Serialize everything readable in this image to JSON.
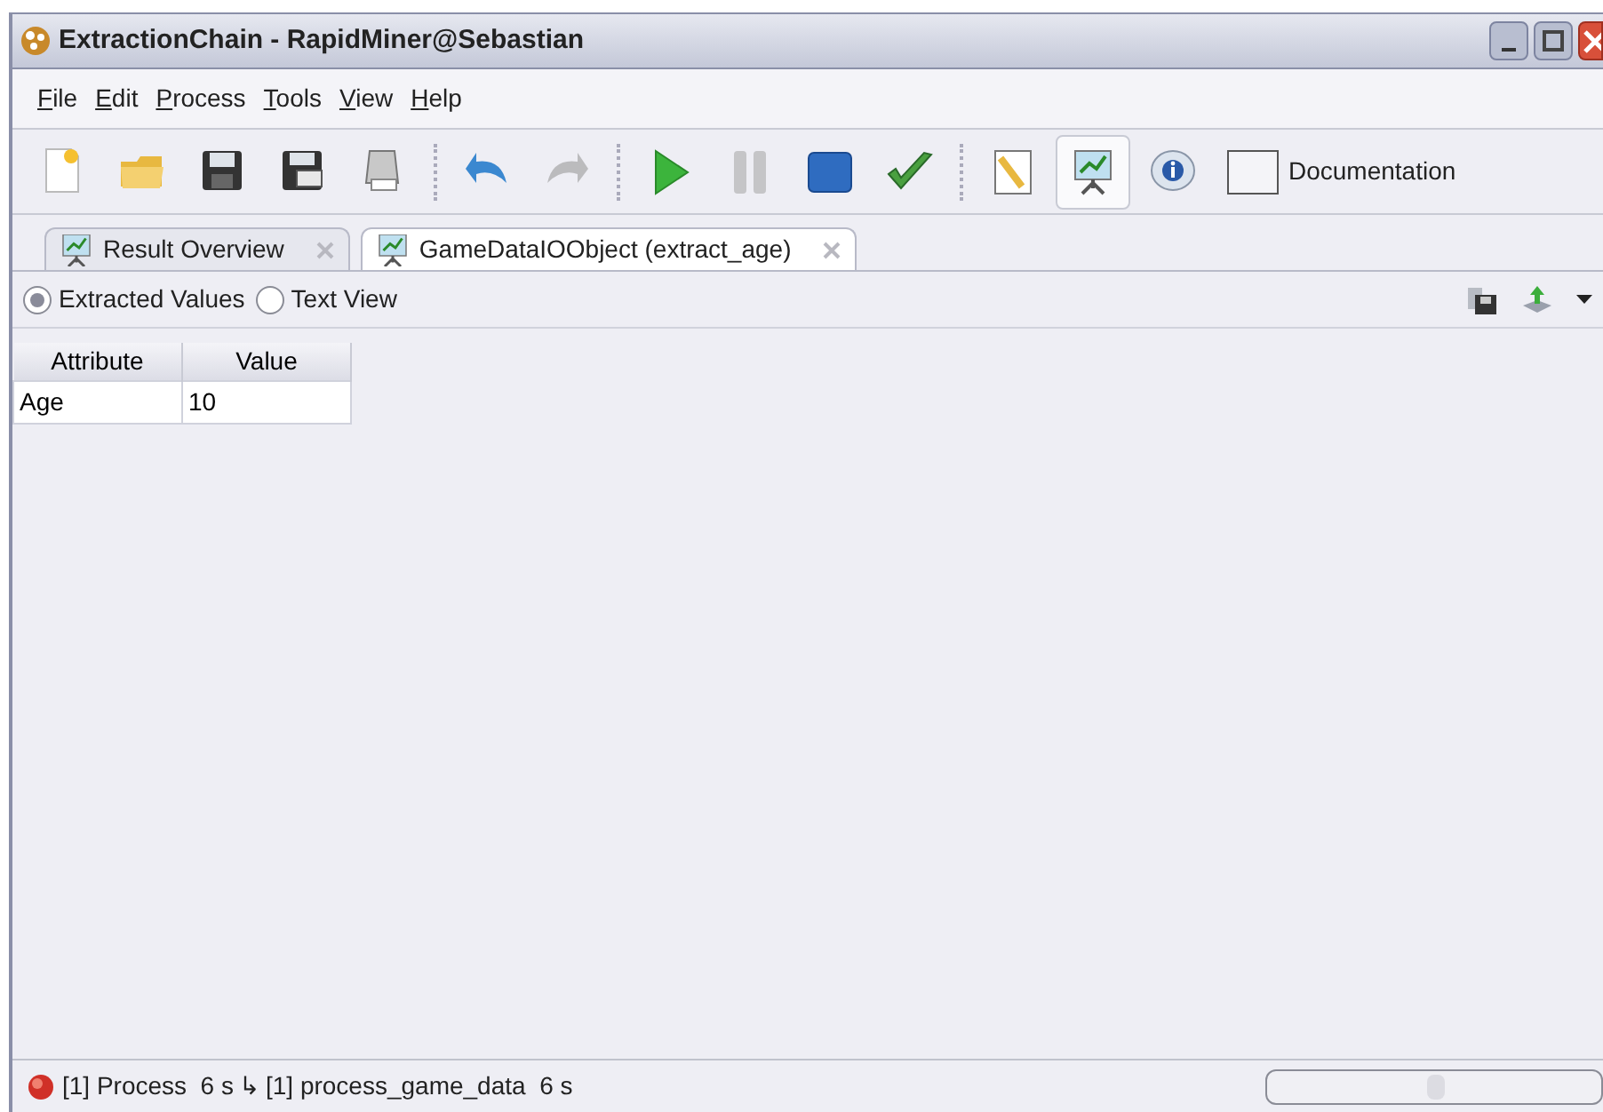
{
  "window": {
    "title": "ExtractionChain - RapidMiner@Sebastian"
  },
  "menu": [
    {
      "label": "File"
    },
    {
      "label": "Edit"
    },
    {
      "label": "Process"
    },
    {
      "label": "Tools"
    },
    {
      "label": "View"
    },
    {
      "label": "Help"
    }
  ],
  "toolbar": [
    {
      "kind": "new",
      "selected": false
    },
    {
      "kind": "open",
      "selected": false
    },
    {
      "kind": "save",
      "selected": false
    },
    {
      "kind": "saveas",
      "selected": false
    },
    {
      "kind": "print",
      "selected": false
    },
    {
      "kind": "sep"
    },
    {
      "kind": "undo",
      "selected": false
    },
    {
      "kind": "redo",
      "selected": false,
      "disabled": true
    },
    {
      "kind": "sep"
    },
    {
      "kind": "run",
      "selected": false
    },
    {
      "kind": "pause",
      "selected": false,
      "disabled": true
    },
    {
      "kind": "stop",
      "selected": false
    },
    {
      "kind": "check",
      "selected": false
    },
    {
      "kind": "sep"
    },
    {
      "kind": "notes",
      "selected": false
    },
    {
      "kind": "results",
      "selected": true
    },
    {
      "kind": "info",
      "selected": false
    },
    {
      "kind": "doc",
      "selected": false,
      "label": "Documentation"
    }
  ],
  "tabs": [
    {
      "label": "Result Overview",
      "selected": false
    },
    {
      "label": "GameDataIOObject (extract_age)",
      "selected": true
    }
  ],
  "view_options": [
    {
      "label": "Extracted Values",
      "selected": true
    },
    {
      "label": "Text View",
      "selected": false
    }
  ],
  "table": {
    "columns": [
      "Attribute",
      "Value"
    ],
    "rows": [
      [
        "Age",
        "10"
      ]
    ]
  },
  "status_bar": {
    "process": "[1] Process  6 s",
    "arrow": "↳",
    "operator": "[1] process_game_data  6 s",
    "progress": {
      "level": 0
    }
  }
}
